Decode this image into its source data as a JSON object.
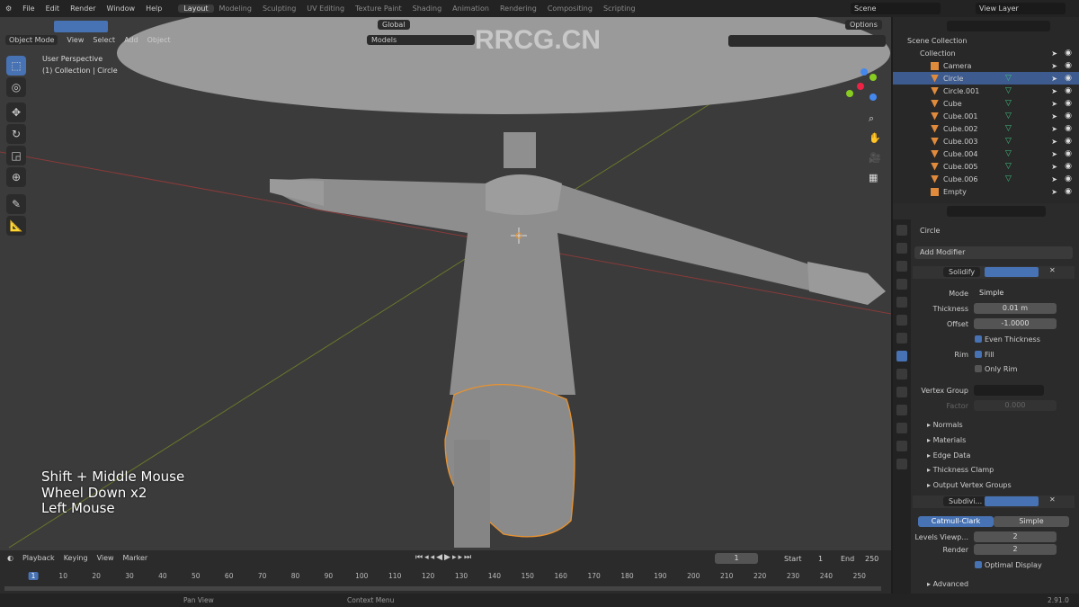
{
  "topbar": {
    "menus": [
      "File",
      "Edit",
      "Render",
      "Window",
      "Help"
    ],
    "workspaces": [
      "Layout",
      "Modeling",
      "Sculpting",
      "UV Editing",
      "Texture Paint",
      "Shading",
      "Animation",
      "Rendering",
      "Compositing",
      "Scripting"
    ],
    "active_workspace": "Layout",
    "scene": "Scene",
    "view_layer": "View Layer"
  },
  "viewport": {
    "mode": "Object Mode",
    "menus": [
      "View",
      "Select",
      "Add",
      "Object"
    ],
    "orientation": "Global",
    "options": "Options",
    "collection_filter": "Models",
    "info_line1": "User Perspective",
    "info_line2": "(1) Collection | Circle",
    "keys": [
      "Shift + Middle Mouse",
      "Wheel Down x2",
      "Left Mouse"
    ],
    "watermark": "RRCG.CN"
  },
  "outliner": {
    "root": "Scene Collection",
    "collection": "Collection",
    "items": [
      {
        "name": "Camera",
        "type": "camera"
      },
      {
        "name": "Circle",
        "type": "mesh",
        "selected": true
      },
      {
        "name": "Circle.001",
        "type": "mesh"
      },
      {
        "name": "Cube",
        "type": "mesh"
      },
      {
        "name": "Cube.001",
        "type": "mesh"
      },
      {
        "name": "Cube.002",
        "type": "mesh"
      },
      {
        "name": "Cube.003",
        "type": "mesh"
      },
      {
        "name": "Cube.004",
        "type": "mesh"
      },
      {
        "name": "Cube.005",
        "type": "mesh"
      },
      {
        "name": "Cube.006",
        "type": "mesh"
      },
      {
        "name": "Empty",
        "type": "empty"
      }
    ]
  },
  "properties": {
    "object": "Circle",
    "add_modifier": "Add Modifier",
    "solidify": {
      "name": "Solidify",
      "mode_label": "Mode",
      "mode": "Simple",
      "thickness_label": "Thickness",
      "thickness": "0.01 m",
      "offset_label": "Offset",
      "offset": "-1.0000",
      "even_thickness": "Even Thickness",
      "rim_label": "Rim",
      "fill": "Fill",
      "only_rim": "Only Rim",
      "vertex_group_label": "Vertex Group",
      "factor_label": "Factor",
      "factor": "0.000",
      "sections": [
        "Normals",
        "Materials",
        "Edge Data",
        "Thickness Clamp",
        "Output Vertex Groups"
      ]
    },
    "subdivision": {
      "name": "Subdivi...",
      "catmull": "Catmull-Clark",
      "simple": "Simple",
      "levels_label": "Levels Viewp...",
      "levels": "2",
      "render_label": "Render",
      "render": "2",
      "optimal": "Optimal Display",
      "advanced": "Advanced"
    }
  },
  "timeline": {
    "menus": [
      "Playback",
      "Keying",
      "View",
      "Marker"
    ],
    "current_frame": "1",
    "start_label": "Start",
    "start": "1",
    "end_label": "End",
    "end": "250",
    "ticks": [
      1,
      10,
      20,
      30,
      40,
      50,
      60,
      70,
      80,
      90,
      100,
      110,
      120,
      130,
      140,
      150,
      160,
      170,
      180,
      190,
      200,
      210,
      220,
      230,
      240,
      250
    ]
  },
  "statusbar": {
    "pan": "Pan View",
    "context": "Context Menu",
    "version": "2.91.0"
  },
  "colors": {
    "accent": "#4772b3",
    "selection_outline": "#e8922f",
    "object_orange": "#e08a3c"
  }
}
